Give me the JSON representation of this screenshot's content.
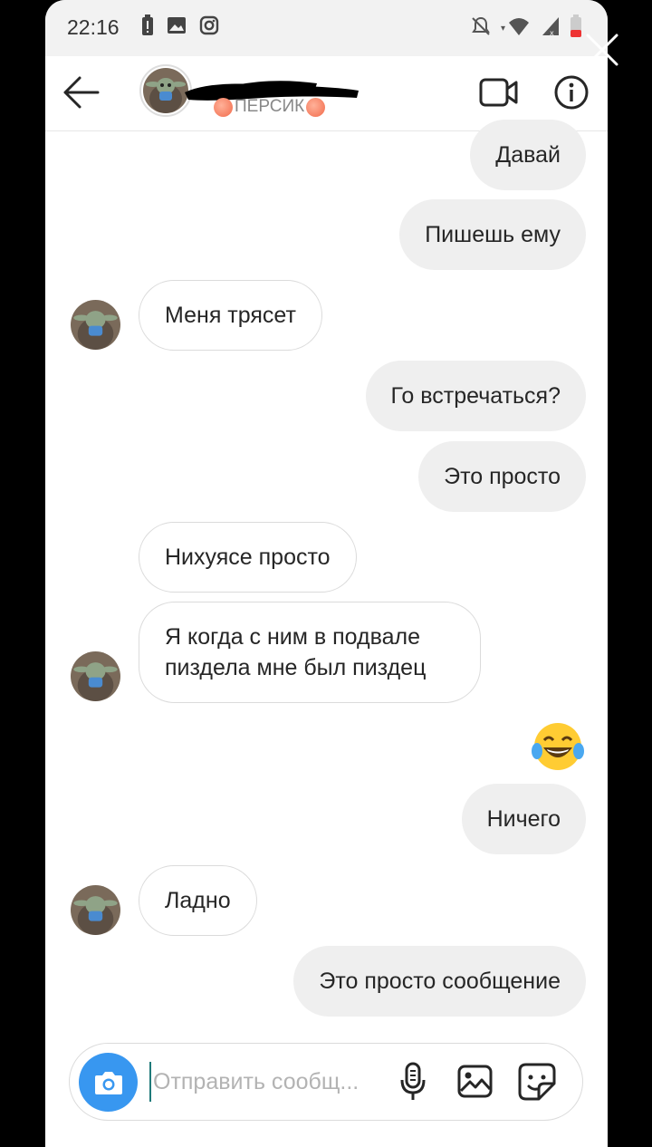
{
  "status_bar": {
    "time": "22:16"
  },
  "header": {
    "subtitle": "ПЕРСИК"
  },
  "messages": [
    {
      "dir": "out",
      "text": "Давай"
    },
    {
      "dir": "out",
      "text": "Пишешь ему"
    },
    {
      "dir": "in",
      "text": "Меня трясет"
    },
    {
      "dir": "out",
      "text": "Го встречаться?"
    },
    {
      "dir": "out",
      "text": "Это просто"
    },
    {
      "dir": "in",
      "text": "Нихуясе просто"
    },
    {
      "dir": "in",
      "text": "Я когда с ним в подвале пиздела мне был пиздец"
    },
    {
      "dir": "out",
      "emoji": "face-with-tears-of-joy"
    },
    {
      "dir": "out",
      "text": "Ничего"
    },
    {
      "dir": "in",
      "text": "Ладно"
    },
    {
      "dir": "out",
      "text": "Это просто сообщение"
    }
  ],
  "composer": {
    "placeholder": "Отправить сообщ..."
  },
  "colors": {
    "accent": "#3897f0",
    "out_bubble": "#efefef",
    "in_border": "#dbdbdb"
  }
}
